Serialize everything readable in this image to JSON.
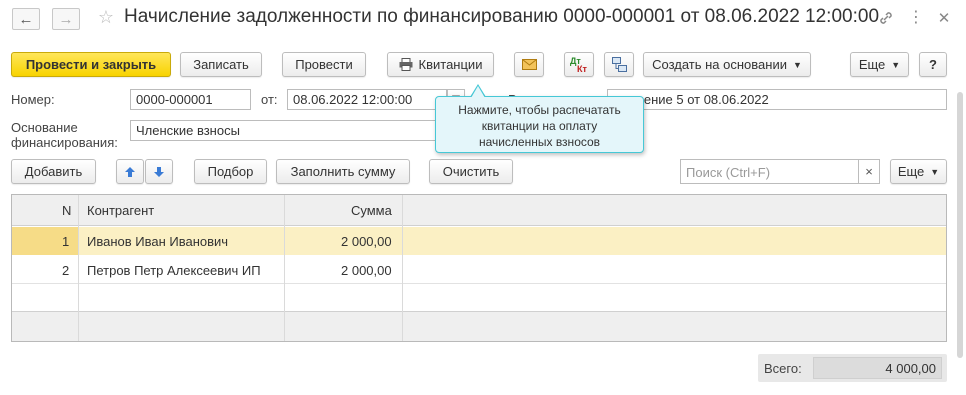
{
  "window": {
    "title": "Начисление задолженности по финансированию 0000-000001 от 08.06.2022 12:00:00"
  },
  "toolbar": {
    "post_close": "Провести и закрыть",
    "write": "Записать",
    "post": "Провести",
    "receipts": "Квитанции",
    "dt_label": "Дт",
    "kt_label": "Кт",
    "create_based": "Создать на основании",
    "more": "Еще",
    "help": "?"
  },
  "form": {
    "number_label": "Номер:",
    "number_value": "0000-000001",
    "date_label": "от:",
    "date_value": "08.06.2022 12:00:00",
    "partial_label": "Р",
    "right_field_value": "...ение 5 от 08.06.2022",
    "basis_label_line1": "Основание",
    "basis_label_line2": "финансирования:",
    "basis_value": "Членские взносы"
  },
  "tooltip": {
    "line1": "Нажмите, чтобы распечатать",
    "line2": "квитанции на оплату",
    "line3": "начисленных взносов"
  },
  "table_toolbar": {
    "add": "Добавить",
    "pick": "Подбор",
    "fill_sum": "Заполнить сумму",
    "clear": "Очистить",
    "search_placeholder": "Поиск (Ctrl+F)",
    "search_clear": "×",
    "more": "Еще"
  },
  "table": {
    "columns": [
      "N",
      "Контрагент",
      "Сумма"
    ],
    "rows": [
      {
        "n": "1",
        "counterparty": "Иванов Иван Иванович",
        "sum": "2 000,00"
      },
      {
        "n": "2",
        "counterparty": "Петров Петр Алексеевич ИП",
        "sum": "2 000,00"
      }
    ]
  },
  "totals": {
    "label": "Всего:",
    "value": "4 000,00"
  },
  "colors": {
    "accent_yellow": "#f8d300",
    "selected_row": "#fbf0c4",
    "tooltip_border": "#46c8d6",
    "tooltip_bg": "#e4f6fa"
  }
}
